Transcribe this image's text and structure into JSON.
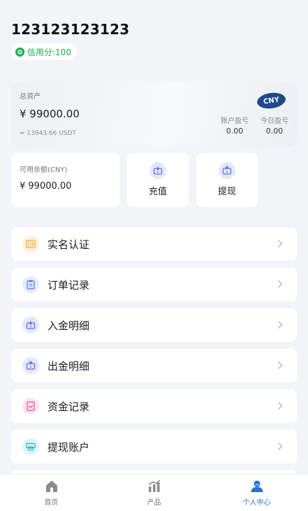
{
  "profile": {
    "user_id": "123123123123",
    "credit_label": "信用分:100"
  },
  "assets": {
    "total_label": "总资产",
    "total_value": "¥ 99000.00",
    "usdt_value": "≈ 13943.66 USDT",
    "currency_badge": "CNY",
    "account_pnl_label": "账户盈亏",
    "account_pnl_value": "0.00",
    "today_pnl_label": "今日盈亏",
    "today_pnl_value": "0.00"
  },
  "balance": {
    "label": "可用余额(CNY)",
    "value": "¥ 99000.00"
  },
  "actions": {
    "recharge": "充值",
    "withdraw": "提现"
  },
  "menu": [
    {
      "label": "实名认证",
      "icon": "id-card-icon",
      "color": "#f0a93b",
      "bg": "#fdf0dc"
    },
    {
      "label": "订单记录",
      "icon": "clipboard-icon",
      "color": "#4a74e8",
      "bg": "#e4ebfc"
    },
    {
      "label": "入金明细",
      "icon": "deposit-icon",
      "color": "#5b6fe0",
      "bg": "#e4e8fb"
    },
    {
      "label": "出金明细",
      "icon": "withdraw-icon",
      "color": "#5b6fe0",
      "bg": "#e4e8fb"
    },
    {
      "label": "资金记录",
      "icon": "ledger-icon",
      "color": "#e24f8c",
      "bg": "#fbe3ee"
    },
    {
      "label": "提现账户",
      "icon": "account-card-icon",
      "color": "#1fb2c9",
      "bg": "#dcf5f9"
    }
  ],
  "tabs": [
    {
      "label": "首页",
      "icon": "home-icon",
      "active": false
    },
    {
      "label": "产品",
      "icon": "chart-icon",
      "active": false
    },
    {
      "label": "个人中心",
      "icon": "user-icon",
      "active": true
    }
  ],
  "colors": {
    "accent": "#2273d8",
    "credit_green": "#1aab4f",
    "badge_blue": "#1d4a8c"
  }
}
